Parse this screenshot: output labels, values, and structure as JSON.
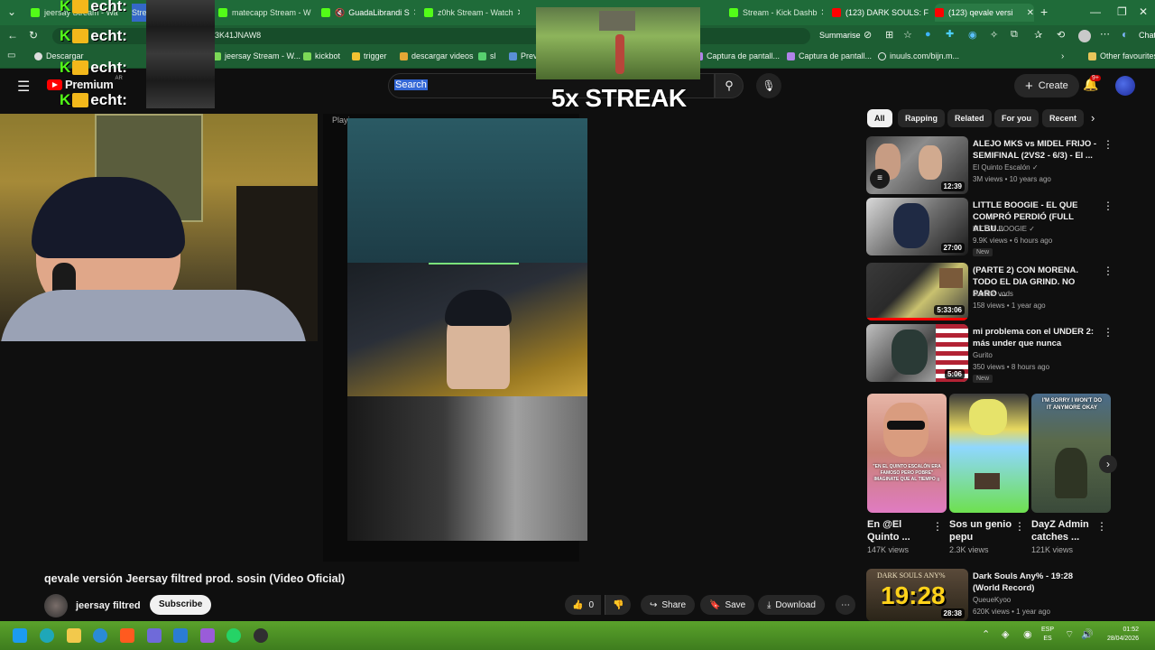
{
  "browser": {
    "tabs": [
      {
        "title": "jeersay Stream - Wa",
        "color": "#53fc18"
      },
      {
        "title": "Stream - Kick",
        "color": "#53fc18"
      },
      {
        "title": "matecapp Stream - W",
        "color": "#53fc18"
      },
      {
        "title": "GuadaLibrandi S",
        "color": "#53fc18"
      },
      {
        "title": "z0hk Stream - Watch",
        "color": "#53fc18"
      },
      {
        "title": "Stream - Kick Dashb",
        "color": "#53fc18"
      },
      {
        "title": "(123) DARK SOULS: F",
        "color": "#ff0000"
      },
      {
        "title": "(123) qevale versi",
        "color": "#ff0000"
      }
    ],
    "url_fragment": "3K41JNAW8",
    "summarise_label": "Summarise",
    "chat_label": "Chat",
    "bookmarks": [
      {
        "label": "Descargar"
      },
      {
        "label": "jeersay Stream - W..."
      },
      {
        "label": "kickbot"
      },
      {
        "label": "trigger"
      },
      {
        "label": "descargar videos"
      },
      {
        "label": "sl"
      },
      {
        "label": "Prev"
      },
      {
        "label": "Captura de pantall..."
      },
      {
        "label": "Captura de pantall..."
      },
      {
        "label": "inuuls.com/bijn.m..."
      },
      {
        "label": "Other favourites"
      }
    ]
  },
  "overlay": {
    "kick_text": "echt:",
    "streak_text": "5x STREAK"
  },
  "youtube": {
    "logo_text": "Premium",
    "logo_region": "AR",
    "search_placeholder": "Search",
    "create_label": "Create",
    "notif_count": "9+",
    "player_label": "Playi",
    "chips": [
      "All",
      "Rapping",
      "Related",
      "For you",
      "Recent"
    ],
    "video": {
      "title": "qevale versión Jeersay filtred prod. sosin (Video Oficial)",
      "channel": "jeersay filtred",
      "subscribe_label": "Subscribe",
      "likes": "0",
      "share_label": "Share",
      "save_label": "Save",
      "download_label": "Download"
    },
    "recommendations": [
      {
        "title": "ALEJO MKS vs MIDEL FRIJO - SEMIFINAL (2VS2 - 6/3) - El ...",
        "channel": "El Quinto Escalón",
        "verified": true,
        "meta": "3M views • 10 years ago",
        "duration": "12:39",
        "is_new": false
      },
      {
        "title": "LITTLE BOOGIE - EL QUE COMPRÓ PERDIÓ (FULL ALBU...",
        "channel": "LITTLE BOOGIE",
        "verified": true,
        "meta": "9.9K views • 6 hours ago",
        "duration": "27:00",
        "is_new": true
      },
      {
        "title": "(PARTE 2) CON MORENA. TODO EL DIA GRIND. NO PARO ...",
        "channel": "starsito vods",
        "verified": false,
        "meta": "158 views • 1 year ago",
        "duration": "5:33:06",
        "is_new": false
      },
      {
        "title": "mi problema con el UNDER 2: más under que nunca",
        "channel": "Gurito",
        "verified": false,
        "meta": "350 views • 8 hours ago",
        "duration": "5:06",
        "is_new": true
      }
    ],
    "new_badge": "New",
    "shorts": [
      {
        "title": "En @El Quinto ...",
        "views": "147K views",
        "caption": "\"EN EL QUINTO ESCALÓN ERA FAMOSO PERO POBRE\" IMAGINATE QUE AL TIEMPO ¡¡"
      },
      {
        "title": "Sos un genio pepu",
        "views": "2.3K views"
      },
      {
        "title": "DayZ Admin catches ...",
        "views": "121K views",
        "caption": "I'M SORRY I WON'T DO IT ANYMORE OKAY"
      }
    ],
    "bottom_rec": {
      "title": "Dark Souls Any% - 19:28 (World Record)",
      "channel": "QueueKyoo",
      "meta": "620K views • 1 year ago",
      "duration": "28:38",
      "thumb_text": "DARK SOULS ANY%",
      "thumb_time": "19:28"
    }
  },
  "taskbar": {
    "lang_top": "ESP",
    "lang_bottom": "ES",
    "time": "01:52",
    "date": "28/04/2026"
  }
}
